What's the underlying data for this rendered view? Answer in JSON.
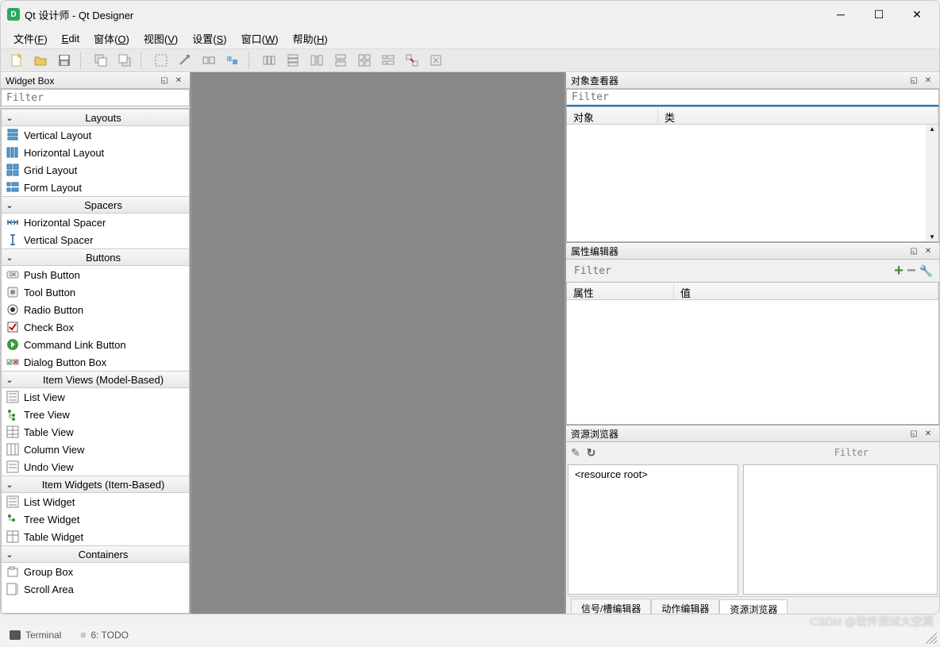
{
  "window": {
    "title": "Qt 设计师 - Qt Designer"
  },
  "menu": {
    "file": "文件",
    "file_u": "F",
    "edit": "Edit",
    "form": "窗体",
    "form_u": "O",
    "view": "视图",
    "view_u": "V",
    "settings": "设置",
    "settings_u": "S",
    "window": "窗口",
    "window_u": "W",
    "help": "帮助",
    "help_u": "H"
  },
  "widget_box": {
    "title": "Widget Box",
    "filter_placeholder": "Filter",
    "categories": [
      {
        "name": "Layouts",
        "items": [
          "Vertical Layout",
          "Horizontal Layout",
          "Grid Layout",
          "Form Layout"
        ]
      },
      {
        "name": "Spacers",
        "items": [
          "Horizontal Spacer",
          "Vertical Spacer"
        ]
      },
      {
        "name": "Buttons",
        "items": [
          "Push Button",
          "Tool Button",
          "Radio Button",
          "Check Box",
          "Command Link Button",
          "Dialog Button Box"
        ]
      },
      {
        "name": "Item Views (Model-Based)",
        "items": [
          "List View",
          "Tree View",
          "Table View",
          "Column View",
          "Undo View"
        ]
      },
      {
        "name": "Item Widgets (Item-Based)",
        "items": [
          "List Widget",
          "Tree Widget",
          "Table Widget"
        ]
      },
      {
        "name": "Containers",
        "items": [
          "Group Box",
          "Scroll Area"
        ]
      }
    ]
  },
  "object_inspector": {
    "title": "对象查看器",
    "filter_placeholder": "Filter",
    "col_object": "对象",
    "col_class": "类"
  },
  "property_editor": {
    "title": "属性编辑器",
    "filter_placeholder": "Filter",
    "col_prop": "属性",
    "col_value": "值"
  },
  "resource_browser": {
    "title": "资源浏览器",
    "filter_placeholder": "Filter",
    "root": "<resource root>"
  },
  "bottom_tabs": {
    "signals": "信号/槽编辑器",
    "actions": "动作编辑器",
    "resources": "资源浏览器"
  },
  "footer": {
    "terminal": "Terminal",
    "todo": "6: TODO"
  },
  "watermark": "CSDN @软件测试大空翼"
}
